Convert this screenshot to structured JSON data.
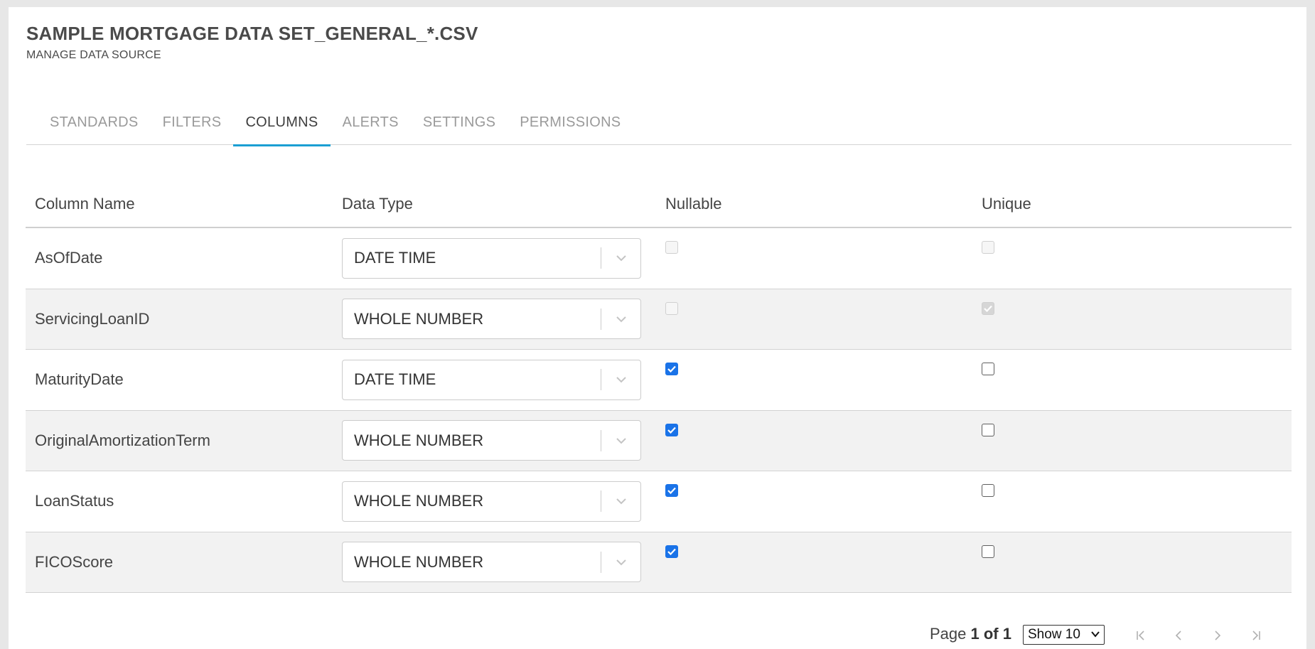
{
  "header": {
    "title": "SAMPLE MORTGAGE DATA SET_GENERAL_*.CSV",
    "subtitle": "MANAGE DATA SOURCE"
  },
  "tabs": [
    {
      "label": "STANDARDS",
      "active": false
    },
    {
      "label": "FILTERS",
      "active": false
    },
    {
      "label": "COLUMNS",
      "active": true
    },
    {
      "label": "ALERTS",
      "active": false
    },
    {
      "label": "SETTINGS",
      "active": false
    },
    {
      "label": "PERMISSIONS",
      "active": false
    }
  ],
  "table": {
    "headers": {
      "column_name": "Column Name",
      "data_type": "Data Type",
      "nullable": "Nullable",
      "unique": "Unique"
    },
    "rows": [
      {
        "name": "AsOfDate",
        "type": "DATE TIME",
        "nullable": false,
        "nullable_disabled": true,
        "unique": false,
        "unique_disabled": true
      },
      {
        "name": "ServicingLoanID",
        "type": "WHOLE NUMBER",
        "nullable": false,
        "nullable_disabled": true,
        "unique": true,
        "unique_disabled": true
      },
      {
        "name": "MaturityDate",
        "type": "DATE TIME",
        "nullable": true,
        "nullable_disabled": false,
        "unique": false,
        "unique_disabled": false
      },
      {
        "name": "OriginalAmortizationTerm",
        "type": "WHOLE NUMBER",
        "nullable": true,
        "nullable_disabled": false,
        "unique": false,
        "unique_disabled": false
      },
      {
        "name": "LoanStatus",
        "type": "WHOLE NUMBER",
        "nullable": true,
        "nullable_disabled": false,
        "unique": false,
        "unique_disabled": false
      },
      {
        "name": "FICOScore",
        "type": "WHOLE NUMBER",
        "nullable": true,
        "nullable_disabled": false,
        "unique": false,
        "unique_disabled": false
      }
    ]
  },
  "pagination": {
    "page_prefix": "Page",
    "page_current": "1 of 1",
    "show_label": "Show 10"
  },
  "colors": {
    "accent": "#1b9fd3",
    "checkbox": "#1a73e8",
    "row_alt": "#f2f2f2"
  },
  "icons": {
    "select": "chevron-down-icon",
    "first": "first-page-icon",
    "prev": "previous-page-icon",
    "next": "next-page-icon",
    "last": "last-page-icon"
  }
}
